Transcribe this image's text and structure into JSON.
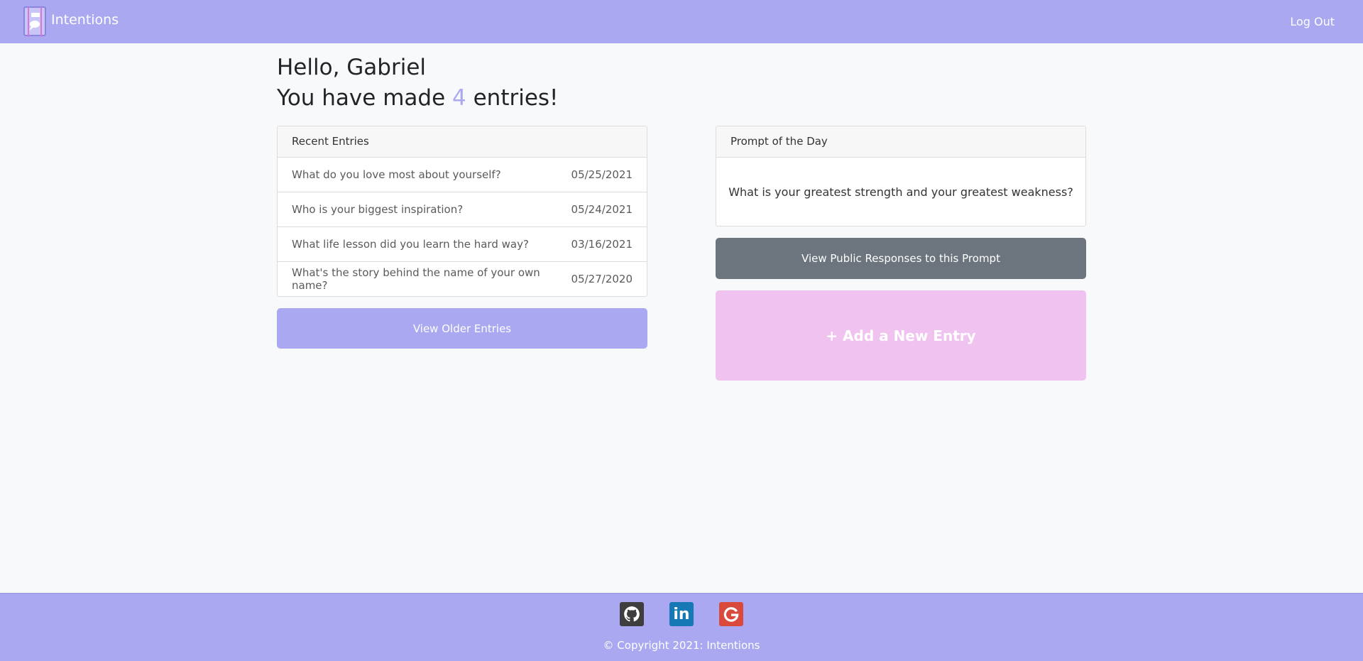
{
  "navbar": {
    "brand": "Intentions",
    "logout_label": "Log Out"
  },
  "greeting": "Hello, Gabriel",
  "entries_line": {
    "prefix": "You have made ",
    "count": "4",
    "suffix": " entries!"
  },
  "recent_entries": {
    "header": "Recent Entries",
    "items": [
      {
        "title": "What do you love most about yourself?",
        "date": "05/25/2021"
      },
      {
        "title": "Who is your biggest inspiration?",
        "date": "05/24/2021"
      },
      {
        "title": "What life lesson did you learn the hard way?",
        "date": "03/16/2021"
      },
      {
        "title": "What's the story behind the name of your own name?",
        "date": "05/27/2020"
      }
    ],
    "older_button": "View Older Entries"
  },
  "prompt": {
    "header": "Prompt of the Day",
    "text": "What is your greatest strength and your greatest weakness?",
    "public_button": "View Public Responses to this Prompt",
    "add_button": "+ Add a New Entry"
  },
  "footer": {
    "social_icons": [
      "github-icon",
      "linkedin-icon",
      "google-icon"
    ],
    "linkedin_glyph": "in",
    "copyright": "© Copyright 2021: Intentions"
  },
  "colors": {
    "accent": "#a9a8f1",
    "pink": "#f0c2ef",
    "gray_button": "#6c757d"
  }
}
